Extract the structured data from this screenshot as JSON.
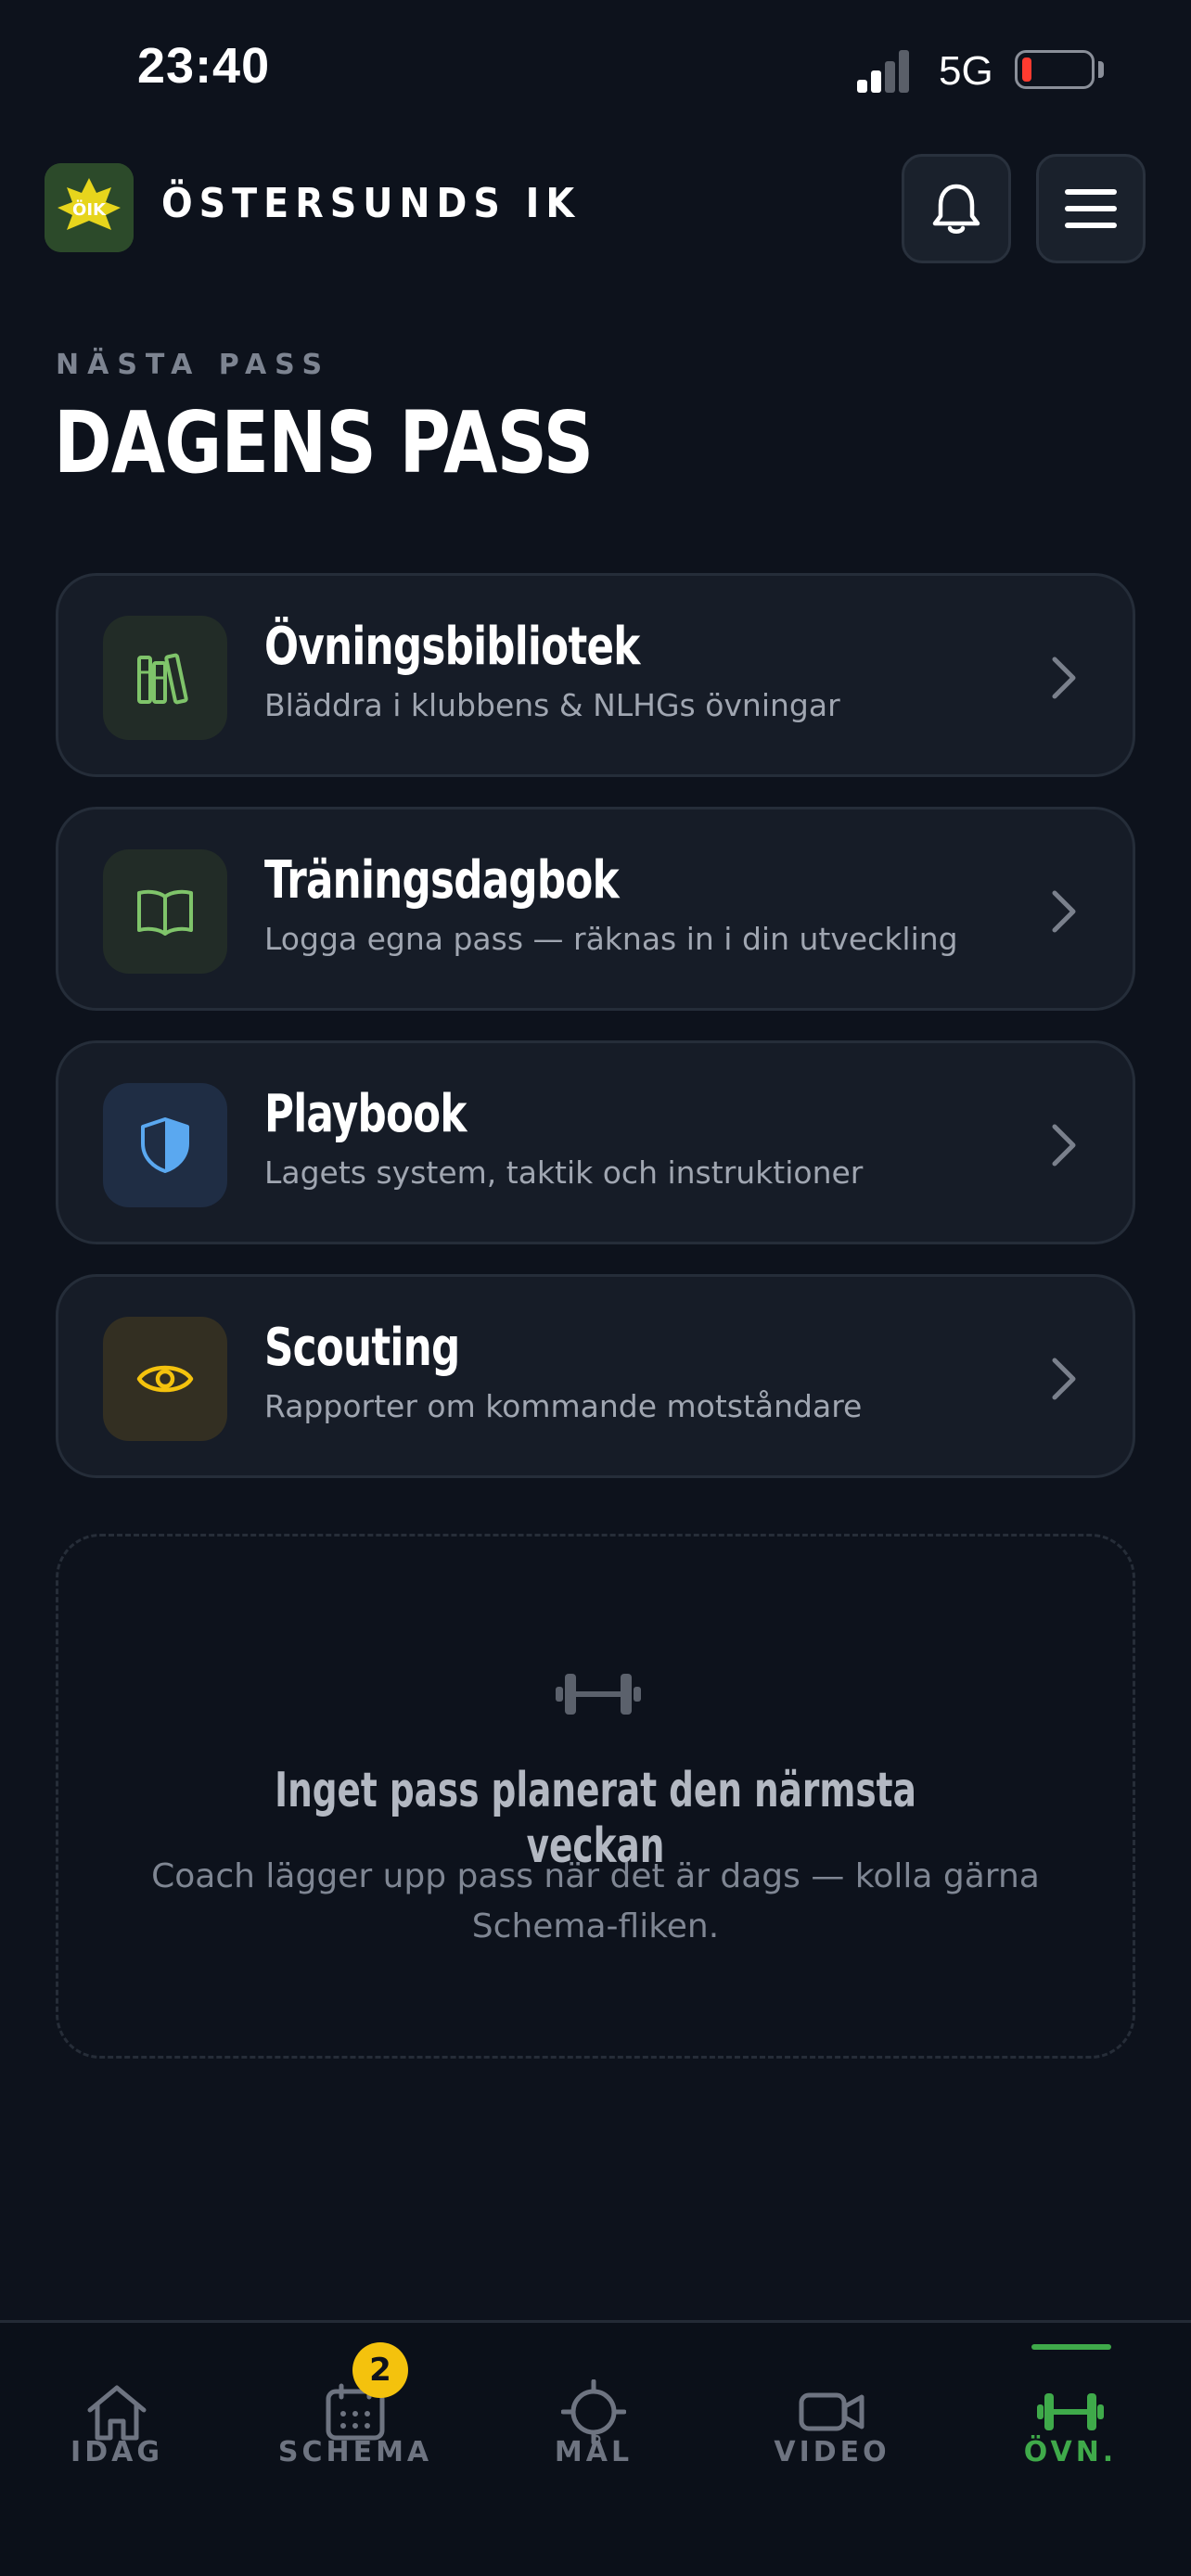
{
  "status_bar": {
    "time": "23:40",
    "network": "5G",
    "battery_level": 0.1
  },
  "header": {
    "club_name": "ÖSTERSUNDS IK",
    "logo_text": "ÖIK"
  },
  "page": {
    "eyebrow": "NÄSTA PASS",
    "title": "DAGENS PASS"
  },
  "cards": [
    {
      "title": "Övningsbibliotek",
      "subtitle": "Bläddra i klubbens & NLHGs övningar",
      "icon": "library-icon",
      "accent": "#7fc46a"
    },
    {
      "title": "Träningsdagbok",
      "subtitle": "Logga egna pass — räknas in i din utveckling",
      "icon": "book-open-icon",
      "accent": "#7fc46a"
    },
    {
      "title": "Playbook",
      "subtitle": "Lagets system, taktik och instruktioner",
      "icon": "shield-icon",
      "accent": "#5aa8f0"
    },
    {
      "title": "Scouting",
      "subtitle": "Rapporter om kommande motståndare",
      "icon": "eye-icon",
      "accent": "#f4c20d"
    }
  ],
  "empty_state": {
    "icon": "dumbbell-icon",
    "title": "Inget pass planerat den närmsta veckan",
    "text": "Coach lägger upp pass när det är dags — kolla gärna Schema-fliken."
  },
  "tabbar": {
    "tabs": [
      {
        "label": "IDAG",
        "icon": "home-icon"
      },
      {
        "label": "SCHEMA",
        "icon": "calendar-icon",
        "badge": "2"
      },
      {
        "label": "MÅL",
        "icon": "target-icon"
      },
      {
        "label": "VIDEO",
        "icon": "video-icon"
      },
      {
        "label": "ÖVN.",
        "icon": "dumbbell-icon",
        "active": true
      }
    ]
  },
  "colors": {
    "background": "#0d121c",
    "card": "#161c27",
    "accent_green": "#3faa4a",
    "badge": "#f4c20d"
  }
}
